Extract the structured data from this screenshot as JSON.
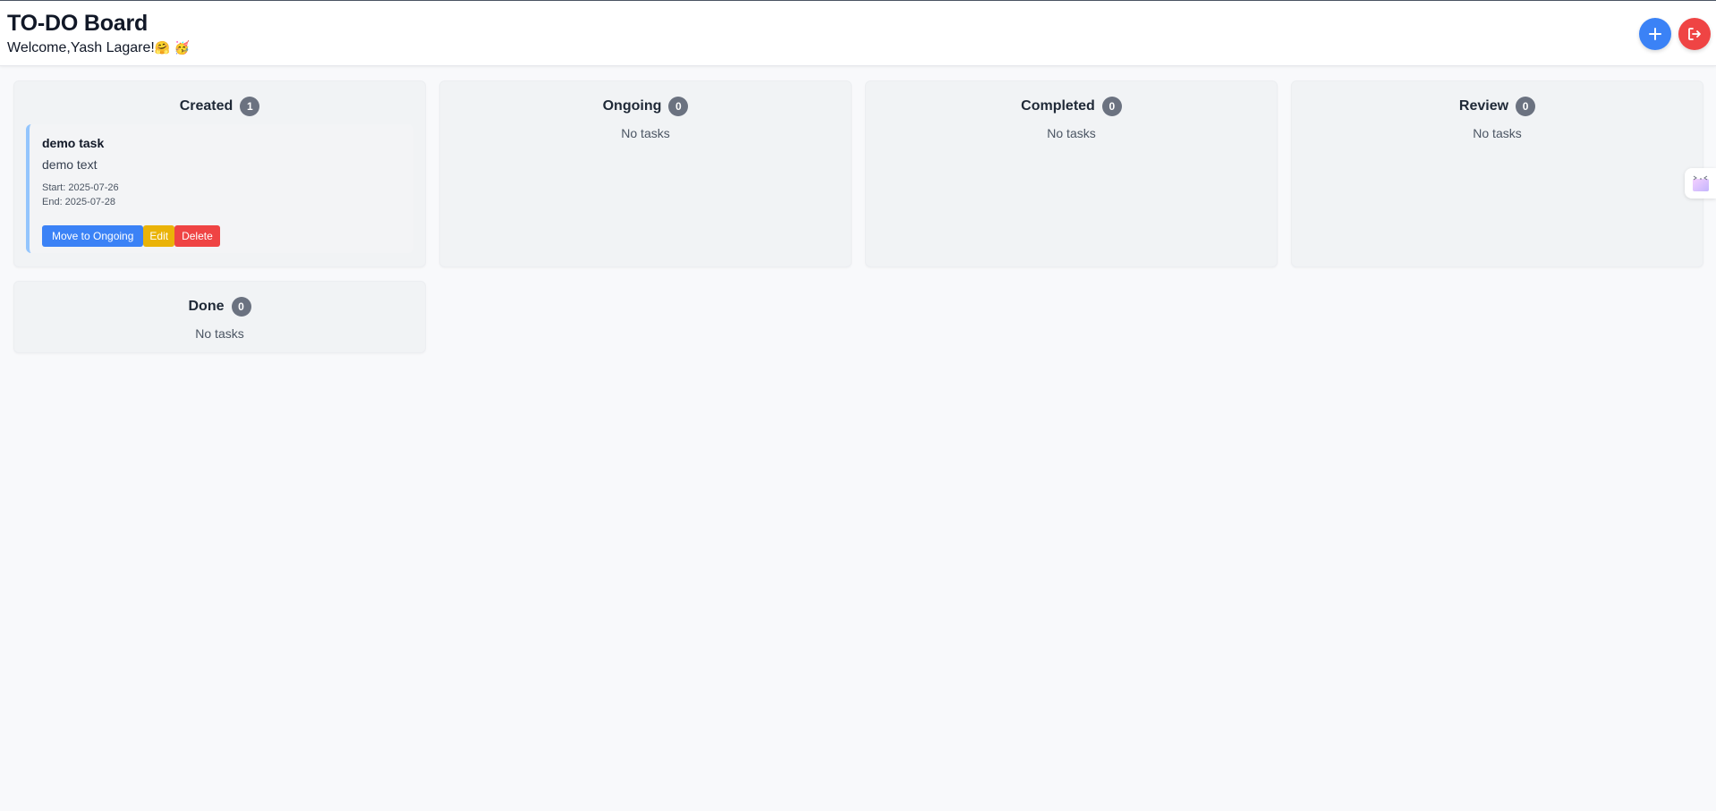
{
  "header": {
    "title": "TO-DO Board",
    "welcome": "Welcome,Yash Lagare!",
    "welcome_emojis": "🤗 🥳",
    "add_icon": "plus-icon",
    "logout_icon": "logout-icon"
  },
  "columns": [
    {
      "title": "Created",
      "count": "1",
      "empty_text": ""
    },
    {
      "title": "Ongoing",
      "count": "0",
      "empty_text": "No tasks"
    },
    {
      "title": "Completed",
      "count": "0",
      "empty_text": "No tasks"
    },
    {
      "title": "Review",
      "count": "0",
      "empty_text": "No tasks"
    },
    {
      "title": "Done",
      "count": "0",
      "empty_text": "No tasks"
    }
  ],
  "task": {
    "title": "demo task",
    "description": "demo text",
    "start": "Start: 2025-07-26",
    "end": "End: 2025-07-28",
    "move_label": "Move to Ongoing",
    "edit_label": "Edit",
    "delete_label": "Delete"
  },
  "colors": {
    "primary": "#3b82f6",
    "danger": "#ef4444",
    "warning": "#eab308",
    "badge": "#6b7280"
  }
}
